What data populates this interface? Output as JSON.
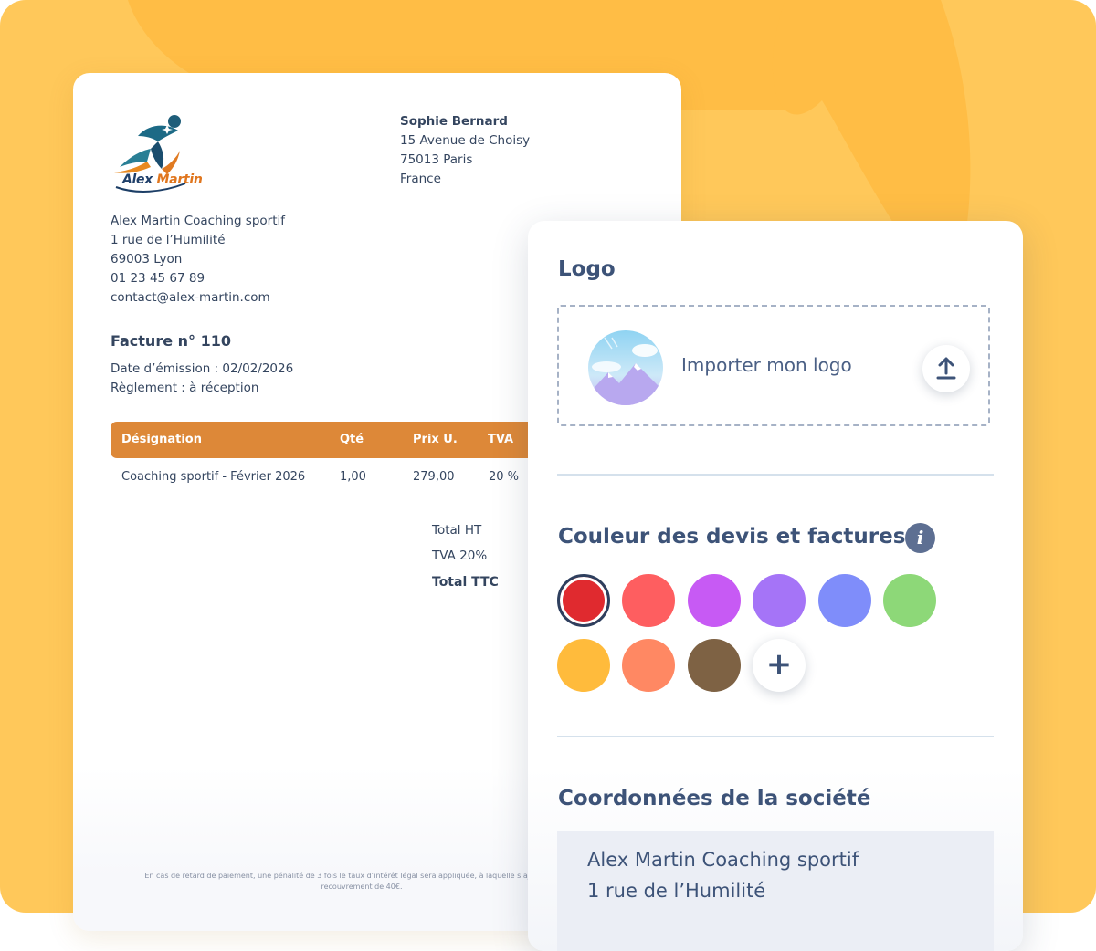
{
  "invoice": {
    "logo": {
      "first_name": "Alex",
      "last_name": "Martin"
    },
    "client": {
      "name": "Sophie Bernard",
      "street": "15 Avenue de Choisy",
      "city": "75013 Paris",
      "country": "France"
    },
    "company": {
      "name": "Alex Martin Coaching sportif",
      "street": "1 rue de l’Humilité",
      "city": "69003 Lyon",
      "phone": "01 23 45 67 89",
      "email": "contact@alex-martin.com"
    },
    "title": "Facture n° 110",
    "issue_date": "Date d’émission : 02/02/2026",
    "payment": "Règlement : à réception",
    "table": {
      "headers": [
        "Désignation",
        "Qté",
        "Prix U.",
        "TVA"
      ],
      "rows": [
        [
          "Coaching sportif - Février 2026",
          "1,00",
          "279,00",
          "20 %"
        ]
      ]
    },
    "totals": {
      "ht": "Total HT",
      "tva": "TVA 20%",
      "ttc": "Total TTC"
    },
    "footer_line1": "En cas de retard de paiement, une pénalité de 3 fois le taux d’intérêt légal sera appliquée, à laquelle s’ajoutera une in",
    "footer_line2": "recouvrement de 40€."
  },
  "panel": {
    "logo_section": {
      "title": "Logo",
      "upload_label": "Importer mon logo",
      "upload_icon": "upload-icon"
    },
    "color_section": {
      "title": "Couleur des devis et factures",
      "info_icon": "i",
      "swatches": [
        "#e02a2f",
        "#fe5e60",
        "#c75af4",
        "#a574f7",
        "#7f8dfa",
        "#8dd878",
        "#ffbb3c",
        "#ff8863",
        "#7e6244"
      ],
      "selected_index": 0,
      "add_label": "+"
    },
    "company_section": {
      "title": "Coordonnées de la société",
      "line1": "Alex Martin Coaching sportif",
      "line2": "1 rue de l’Humilité"
    }
  },
  "colors": {
    "background": "#ffc85a",
    "table_header": "#dd8838",
    "text_dark": "#34455f"
  }
}
